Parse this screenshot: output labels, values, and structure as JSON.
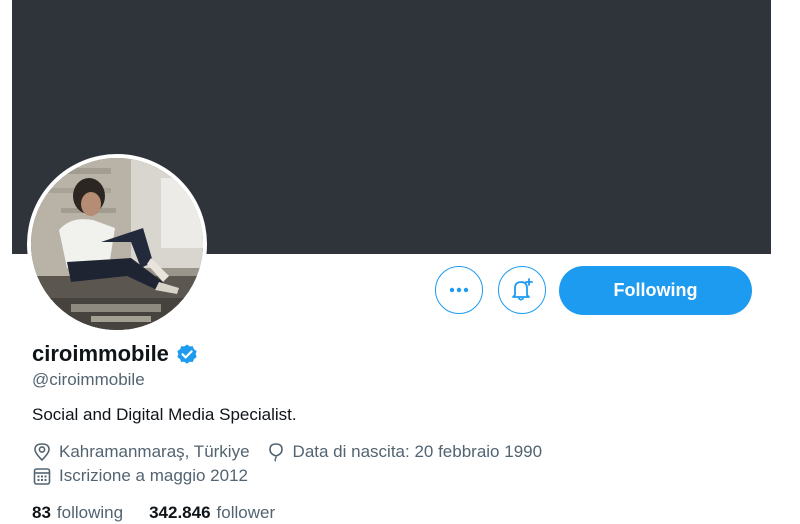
{
  "profile": {
    "display_name": "ciroimmobile",
    "verified": true,
    "handle": "@ciroimmobile",
    "bio": "Social and Digital Media Specialist.",
    "location": "Kahramanmaraş, Türkiye",
    "birthdate": "Data di nascita: 20 febbraio 1990",
    "joined": "Iscrizione a maggio 2012"
  },
  "actions": {
    "more_icon": "more-horizontal-icon",
    "notify_icon": "bell-plus-icon",
    "follow_label": "Following"
  },
  "stats": {
    "following_count": "83",
    "following_label": "following",
    "followers_count": "342.846",
    "followers_label": "follower"
  },
  "colors": {
    "accent": "#1d9bf0",
    "banner": "#2f343b",
    "muted_text": "#536471",
    "primary_text": "#0f1419"
  }
}
